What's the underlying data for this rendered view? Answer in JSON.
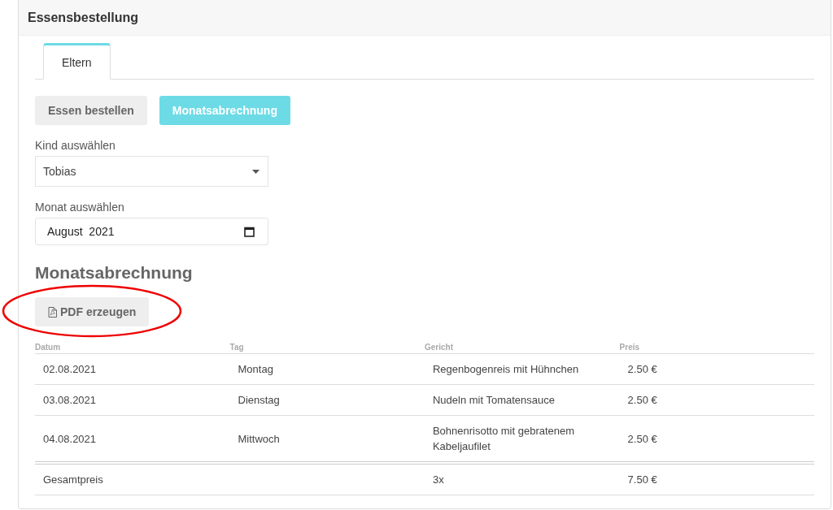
{
  "card": {
    "title": "Essensbestellung"
  },
  "tabs": [
    {
      "label": "Eltern",
      "selected": true
    }
  ],
  "buttons": [
    {
      "label": "Essen bestellen",
      "selected": false
    },
    {
      "label": "Monatsabrechnung",
      "selected": true
    }
  ],
  "child_select": {
    "label": "Kind auswählen",
    "value": "Tobias"
  },
  "month_field": {
    "label": "Monat auswählen",
    "value": "August  2021"
  },
  "section_title": "Monatsabrechnung",
  "pdf_button": {
    "label": "PDF erzeugen",
    "highlighted": true
  },
  "table": {
    "columns": [
      "Datum",
      "Tag",
      "Gericht",
      "Preis"
    ],
    "rows": [
      [
        "02.08.2021",
        "Montag",
        "Regenbogenreis mit Hühnchen",
        "2.50 €"
      ],
      [
        "03.08.2021",
        "Dienstag",
        "Nudeln mit Tomatensauce",
        "2.50 €"
      ],
      [
        "04.08.2021",
        "Mittwoch",
        "Bohnenrisotto mit gebratenem Kabeljaufilet",
        "2.50 €"
      ]
    ],
    "total": {
      "label": "Gesamtpreis",
      "count": "3x",
      "amount": "7.50 €"
    }
  }
}
